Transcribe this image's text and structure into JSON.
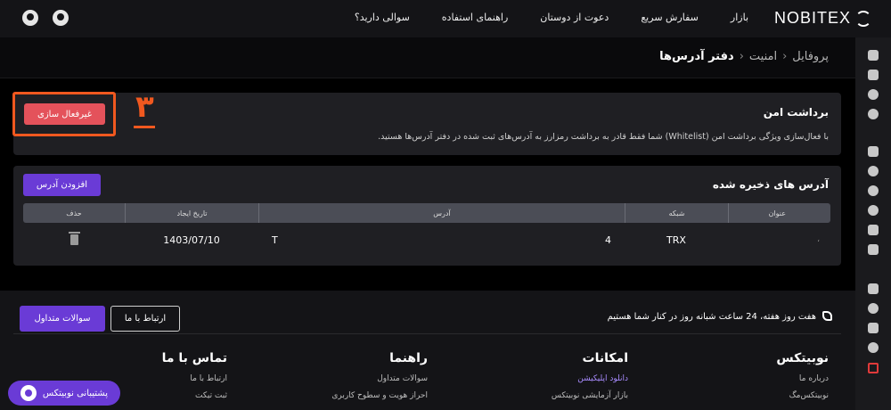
{
  "header": {
    "logo": "NOBITEX",
    "nav": [
      "بازار",
      "سفارش سریع",
      "دعوت از دوستان",
      "راهنمای استفاده",
      "سوالی دارید؟"
    ]
  },
  "breadcrumb": {
    "level1": "پروفایل",
    "level2": "امنیت",
    "level3": "دفتر آدرس‌ها",
    "separator": "›"
  },
  "secure_withdraw": {
    "title": "برداشت امن",
    "description": "با فعال‌سازی ویژگی برداشت امن (Whitelist) شما فقط قادر به برداشت رمزارز به آدرس‌های ثبت شده در دفتر آدرس‌ها هستید.",
    "deactivate_label": "غیرفعال سازی",
    "step_number": "۳",
    "highlight_color": "#f0581f"
  },
  "saved_addresses": {
    "title": "آدرس های ذخیره شده",
    "add_label": "افزودن آدرس",
    "columns": {
      "title": "عنوان",
      "network": "شبکه",
      "address": "آدرس",
      "date": "تاریخ ایجاد",
      "delete": "حذف"
    },
    "rows": [
      {
        "title": "،",
        "network": "TRX",
        "address_start": "T",
        "address_end": "4",
        "date": "1403/07/10"
      }
    ]
  },
  "footer": {
    "support_text": "هفت روز هفته، 24 ساعت شبانه روز در کنار شما هستیم",
    "contact_label": "ارتباط با ما",
    "faq_label": "سوالات متداول",
    "columns": [
      {
        "heading": "نوبیتکس",
        "links": [
          "درباره ما",
          "نوبیتکس‌مگ"
        ]
      },
      {
        "heading": "امکانات",
        "links": [
          "دانلود اپلیکیشن",
          "بازار آزمایشی نوبیتکس"
        ]
      },
      {
        "heading": "راهنما",
        "links": [
          "سوالات متداول",
          "احراز هویت و سطوح کاربری"
        ]
      },
      {
        "heading": "تماس با ما",
        "links": [
          "ارتباط با ما",
          "ثبت تیکت"
        ]
      }
    ],
    "support_pill": "پشتیبانی نوبیتکس"
  },
  "colors": {
    "accent": "#6a3bd6",
    "danger": "#e4525b"
  }
}
